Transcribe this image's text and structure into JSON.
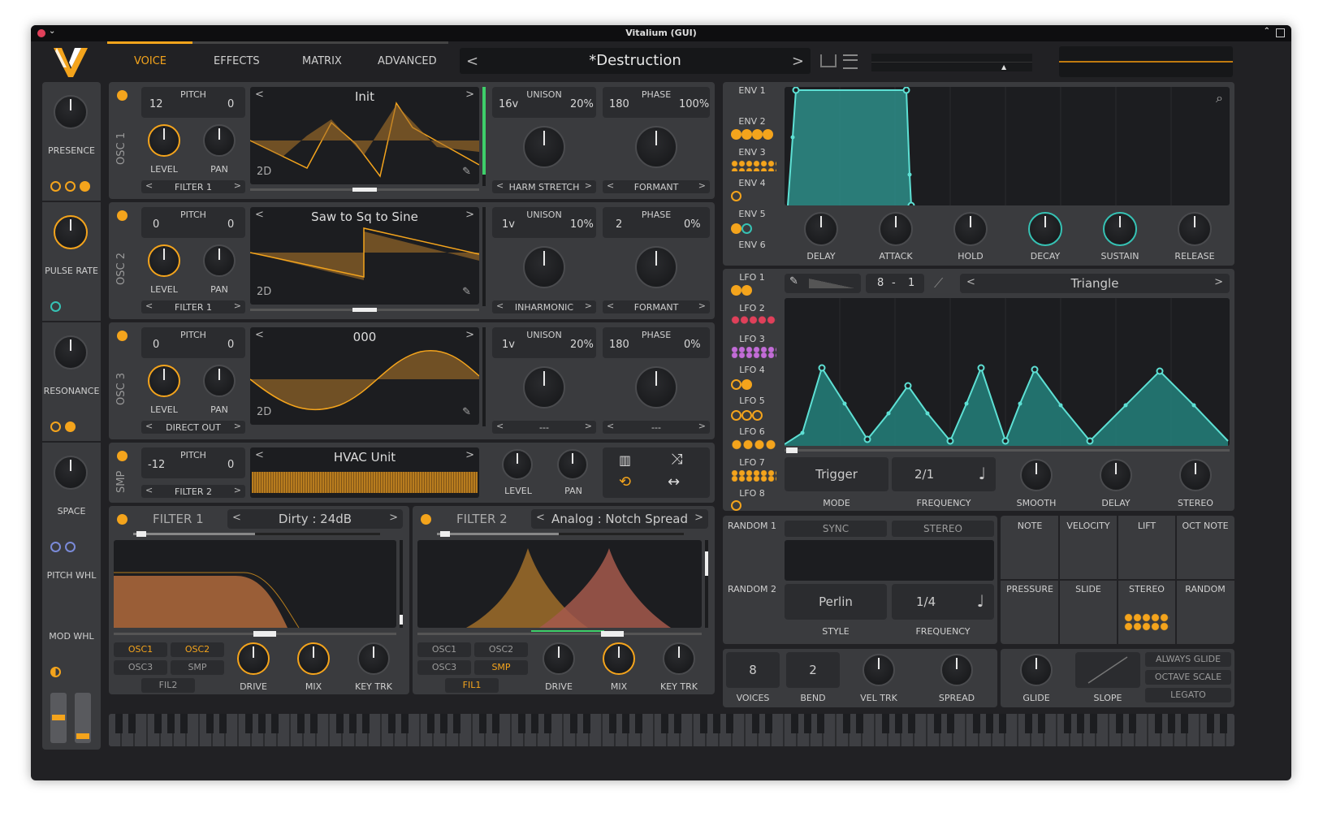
{
  "window": {
    "title": "Vitalium (GUI)"
  },
  "tabs": [
    "VOICE",
    "EFFECTS",
    "MATRIX",
    "ADVANCED"
  ],
  "preset": {
    "name": "*Destruction"
  },
  "macros": [
    {
      "label": "PRESENCE"
    },
    {
      "label": "PULSE RATE"
    },
    {
      "label": "RESONANCE"
    },
    {
      "label": "SPACE"
    }
  ],
  "wheels": {
    "pitch": "PITCH WHL",
    "mod": "MOD WHL"
  },
  "oscillators": [
    {
      "vlabel": "OSC 1",
      "pitch_label": "PITCH",
      "coarse": "12",
      "fine": "0",
      "level": "LEVEL",
      "pan": "PAN",
      "dest": "FILTER 1",
      "wavetable": "Init",
      "mode": "2D",
      "unison_label": "UNISON",
      "voices": "16v",
      "detune": "20%",
      "phase_label": "PHASE",
      "phase": "180",
      "phase_rand": "100%",
      "spectral": "HARM STRETCH",
      "distortion": "FORMANT"
    },
    {
      "vlabel": "OSC 2",
      "pitch_label": "PITCH",
      "coarse": "0",
      "fine": "0",
      "level": "LEVEL",
      "pan": "PAN",
      "dest": "FILTER 1",
      "wavetable": "Saw to Sq to Sine",
      "mode": "2D",
      "unison_label": "UNISON",
      "voices": "1v",
      "detune": "10%",
      "phase_label": "PHASE",
      "phase": "2",
      "phase_rand": "0%",
      "spectral": "INHARMONIC",
      "distortion": "FORMANT"
    },
    {
      "vlabel": "OSC 3",
      "pitch_label": "PITCH",
      "coarse": "0",
      "fine": "0",
      "level": "LEVEL",
      "pan": "PAN",
      "dest": "DIRECT OUT",
      "wavetable": "000",
      "mode": "2D",
      "unison_label": "UNISON",
      "voices": "1v",
      "detune": "20%",
      "phase_label": "PHASE",
      "phase": "180",
      "phase_rand": "0%",
      "spectral": "---",
      "distortion": "---"
    }
  ],
  "sampler": {
    "vlabel": "SMP",
    "pitch_label": "PITCH",
    "coarse": "-12",
    "fine": "0",
    "dest": "FILTER 2",
    "sample": "HVAC Unit",
    "level": "LEVEL",
    "pan": "PAN"
  },
  "filters": [
    {
      "title": "FILTER 1",
      "type": "Dirty : 24dB",
      "sources": [
        "OSC1",
        "OSC2",
        "OSC3",
        "SMP"
      ],
      "chain": "FIL2",
      "drive": "DRIVE",
      "mix": "MIX",
      "keytrk": "KEY TRK"
    },
    {
      "title": "FILTER 2",
      "type": "Analog : Notch Spread",
      "sources": [
        "OSC1",
        "OSC2",
        "OSC3",
        "SMP"
      ],
      "chain": "FIL1",
      "drive": "DRIVE",
      "mix": "MIX",
      "keytrk": "KEY TRK"
    }
  ],
  "envelopes": {
    "tabs": [
      "ENV 1",
      "ENV 2",
      "ENV 3",
      "ENV 4",
      "ENV 5",
      "ENV 6"
    ],
    "knobs": [
      "DELAY",
      "ATTACK",
      "HOLD",
      "DECAY",
      "SUSTAIN",
      "RELEASE"
    ]
  },
  "lfo": {
    "tabs": [
      "LFO 1",
      "LFO 2",
      "LFO 3",
      "LFO 4",
      "LFO 5",
      "LFO 6",
      "LFO 7",
      "LFO 8"
    ],
    "grid_x": "8",
    "grid_sep": "-",
    "grid_y": "1",
    "shape": "Triangle",
    "mode_value": "Trigger",
    "mode_label": "MODE",
    "freq_value": "2/1",
    "freq_label": "FREQUENCY",
    "knobs": [
      "SMOOTH",
      "DELAY",
      "STEREO"
    ]
  },
  "random": {
    "tabs": [
      "RANDOM 1",
      "RANDOM 2"
    ],
    "sync": "SYNC",
    "stereo": "STEREO",
    "style_value": "Perlin",
    "style_label": "STYLE",
    "freq_value": "1/4",
    "freq_label": "FREQUENCY"
  },
  "mod_sources": [
    "NOTE",
    "VELOCITY",
    "LIFT",
    "OCT NOTE",
    "PRESSURE",
    "SLIDE",
    "STEREO",
    "RANDOM"
  ],
  "voice": {
    "voices_value": "8",
    "voices_label": "VOICES",
    "bend_value": "2",
    "bend_label": "BEND",
    "veltrk": "VEL TRK",
    "spread": "SPREAD",
    "glide": "GLIDE",
    "slope": "SLOPE",
    "always_glide": "ALWAYS GLIDE",
    "octave_scale": "OCTAVE SCALE",
    "legato": "LEGATO"
  },
  "colors": {
    "accent": "#f4a41c",
    "mod": "#36c2b4",
    "panel": "#3a3b3e",
    "bg": "#212124"
  }
}
